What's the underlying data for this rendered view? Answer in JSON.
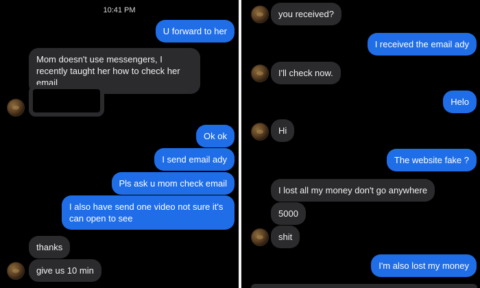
{
  "left_chat": {
    "timestamp": "10:41 PM",
    "messages": [
      {
        "text": "U forward to her"
      },
      {
        "text": "Mom doesn't use messengers, I recently taught her how to check her email"
      },
      {
        "text": "Ok ok"
      },
      {
        "text": "I send email ady"
      },
      {
        "text": "Pls ask u mom check email"
      },
      {
        "text": "I also have send one video not sure it's can open to see"
      },
      {
        "text": "thanks"
      },
      {
        "text": "give us 10 min"
      }
    ]
  },
  "right_chat": {
    "messages": [
      {
        "text": "you received?"
      },
      {
        "text": "I received the email ady"
      },
      {
        "text": "I'll check now."
      },
      {
        "text": "Helo"
      },
      {
        "text": "Hi"
      },
      {
        "text": "The website fake ?"
      },
      {
        "text": "I lost all my money don't go anywhere"
      },
      {
        "text": "5000"
      },
      {
        "text": "shit"
      },
      {
        "text": "I'm also lost my money"
      }
    ]
  },
  "colors": {
    "background": "#000000",
    "outgoing_bubble": "#1f6ee8",
    "incoming_bubble": "#2b2b2e"
  },
  "icons": [
    "contact-avatar-icon"
  ]
}
